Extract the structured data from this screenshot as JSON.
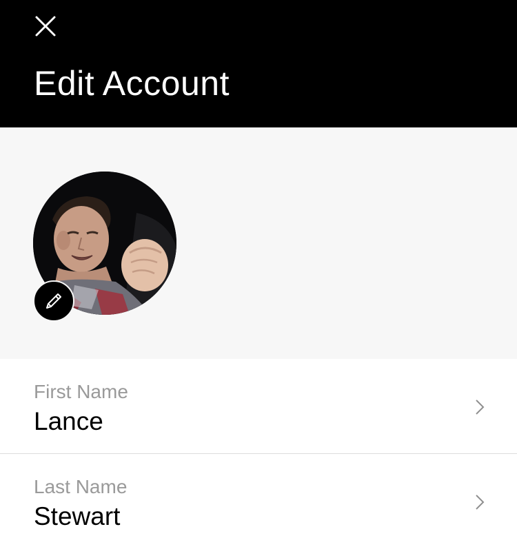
{
  "header": {
    "title": "Edit Account",
    "close_icon": "close-icon"
  },
  "profile": {
    "avatar_icon": "profile-photo",
    "edit_icon": "pencil-icon"
  },
  "fields": [
    {
      "label": "First Name",
      "value": "Lance",
      "icon": "chevron-right-icon"
    },
    {
      "label": "Last Name",
      "value": "Stewart",
      "icon": "chevron-right-icon"
    }
  ],
  "colors": {
    "header_bg": "#000000",
    "profile_bg": "#f7f7f7",
    "label": "#9a9a9a",
    "value": "#000000",
    "divider": "#dcdcdc"
  }
}
